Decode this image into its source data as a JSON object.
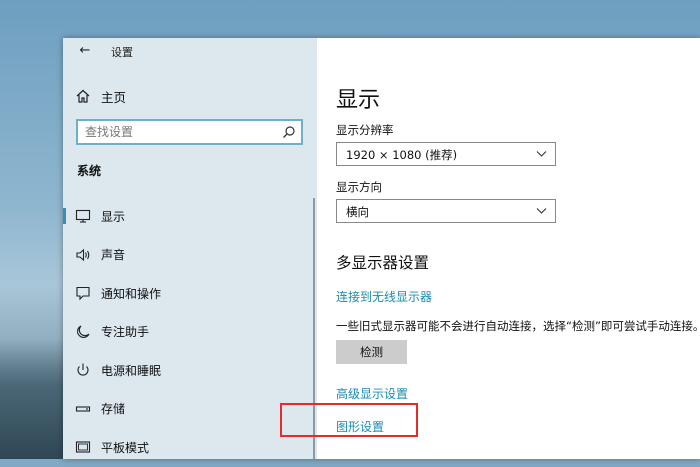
{
  "window": {
    "title": "设置",
    "back": "←"
  },
  "sidebar": {
    "home": "主页",
    "search": {
      "placeholder": "查找设置"
    },
    "section": "系统",
    "items": [
      {
        "label": "显示",
        "icon": "monitor-icon",
        "active": true
      },
      {
        "label": "声音",
        "icon": "speaker-icon"
      },
      {
        "label": "通知和操作",
        "icon": "notification-icon"
      },
      {
        "label": "专注助手",
        "icon": "moon-icon"
      },
      {
        "label": "电源和睡眠",
        "icon": "power-icon"
      },
      {
        "label": "存储",
        "icon": "storage-icon"
      },
      {
        "label": "平板模式",
        "icon": "tablet-icon"
      }
    ]
  },
  "main": {
    "title": "显示",
    "resolution": {
      "label": "显示分辨率",
      "value": "1920 × 1080 (推荐)"
    },
    "orientation": {
      "label": "显示方向",
      "value": "横向"
    },
    "multi_display": {
      "heading": "多显示器设置",
      "wireless_link": "连接到无线显示器",
      "description": "一些旧式显示器可能不会进行自动连接，选择“检测”即可尝试手动连接。",
      "detect_button": "检测"
    },
    "advanced_link": "高级显示设置",
    "graphics_link": "图形设置"
  },
  "colors": {
    "accent": "#1a8cb1",
    "sidebar_bg": "#dce7ee",
    "highlight": "#e52b2b"
  }
}
